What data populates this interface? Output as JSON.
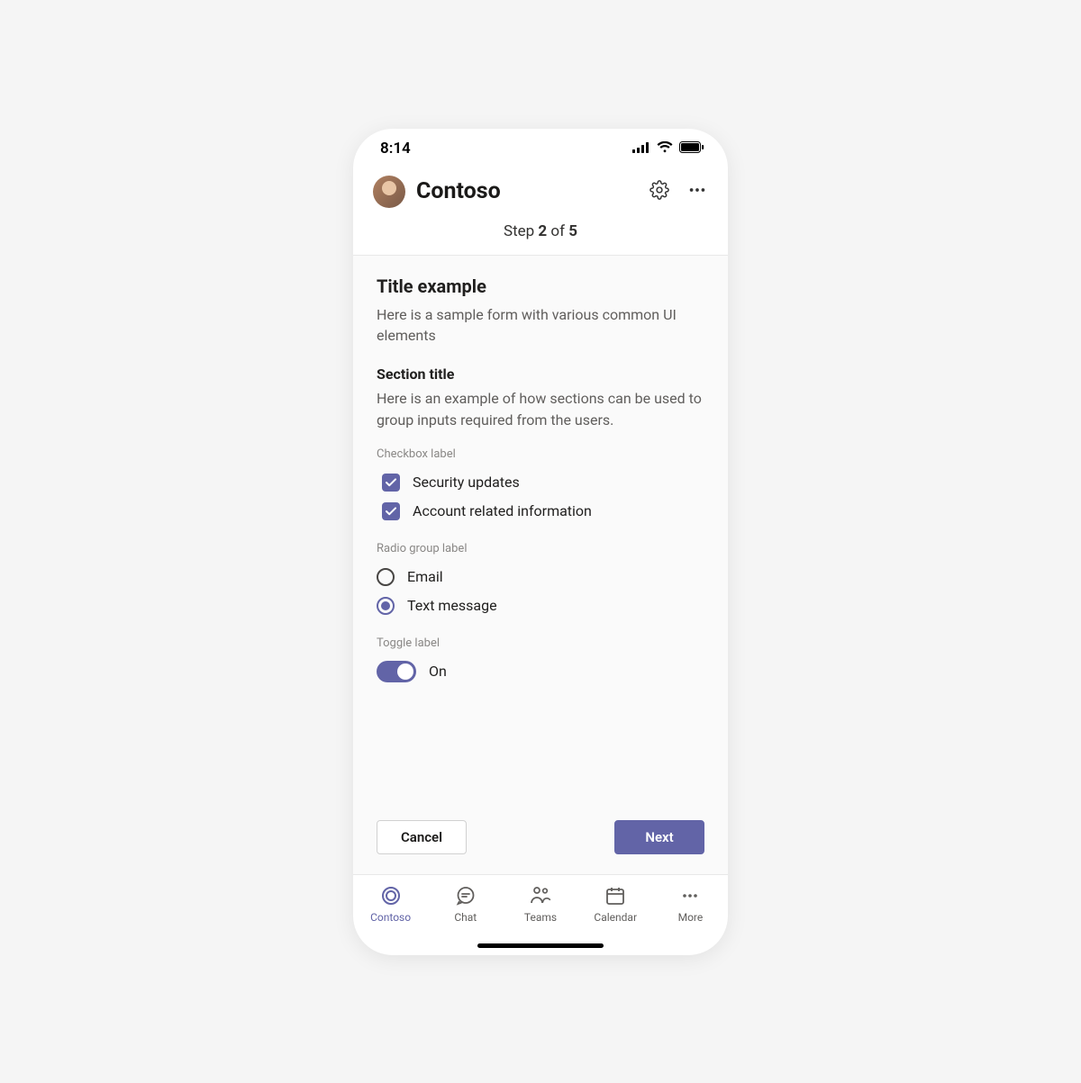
{
  "status": {
    "time": "8:14"
  },
  "header": {
    "app_name": "Contoso"
  },
  "stepper": {
    "prefix": "Step ",
    "current": "2",
    "middle": " of ",
    "total": "5"
  },
  "form": {
    "title": "Title example",
    "description": "Here is a sample form with various common UI elements",
    "section_title": "Section title",
    "section_description": "Here is an example of how sections can be used to group inputs required from the users.",
    "checkbox_group_label": "Checkbox label",
    "checkboxes": [
      {
        "label": "Security updates",
        "checked": true
      },
      {
        "label": "Account related information",
        "checked": true
      }
    ],
    "radio_group_label": "Radio group label",
    "radios": [
      {
        "label": "Email",
        "selected": false
      },
      {
        "label": "Text message",
        "selected": true
      }
    ],
    "toggle_label": "Toggle label",
    "toggle_state_label": "On",
    "toggle_on": true
  },
  "buttons": {
    "cancel": "Cancel",
    "next": "Next"
  },
  "tabs": [
    {
      "id": "contoso",
      "label": "Contoso",
      "active": true
    },
    {
      "id": "chat",
      "label": "Chat",
      "active": false
    },
    {
      "id": "teams",
      "label": "Teams",
      "active": false
    },
    {
      "id": "calendar",
      "label": "Calendar",
      "active": false
    },
    {
      "id": "more",
      "label": "More",
      "active": false
    }
  ],
  "colors": {
    "accent": "#6264a7"
  }
}
